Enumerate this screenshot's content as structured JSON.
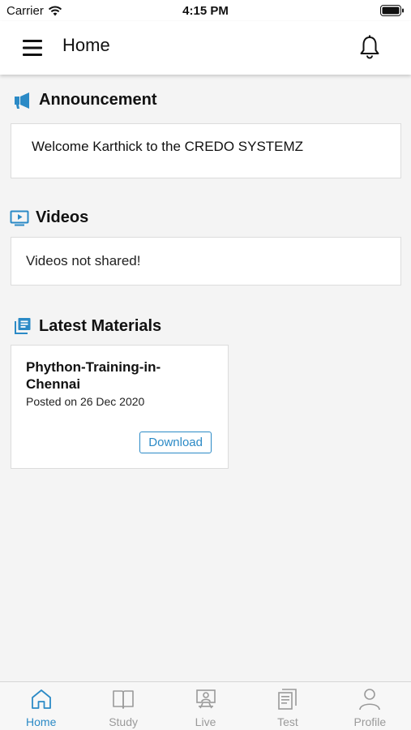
{
  "status_bar": {
    "carrier": "Carrier",
    "time": "4:15 PM"
  },
  "header": {
    "title": "Home",
    "menu_icon": "hamburger-menu-icon",
    "notification_icon": "bell-icon"
  },
  "announcement": {
    "heading": "Announcement",
    "icon": "megaphone-icon",
    "message": "Welcome Karthick to the CREDO SYSTEMZ"
  },
  "videos": {
    "heading": "Videos",
    "icon": "play-video-icon",
    "message": "Videos not shared!"
  },
  "materials": {
    "heading": "Latest Materials",
    "icon": "library-books-icon",
    "items": [
      {
        "title": "Phython-Training-in-Chennai",
        "posted": "Posted on 26 Dec 2020",
        "download_label": "Download"
      }
    ]
  },
  "tabs": [
    {
      "label": "Home",
      "icon": "home-icon",
      "active": true
    },
    {
      "label": "Study",
      "icon": "book-icon",
      "active": false
    },
    {
      "label": "Live",
      "icon": "live-class-icon",
      "active": false
    },
    {
      "label": "Test",
      "icon": "test-icon",
      "active": false
    },
    {
      "label": "Profile",
      "icon": "profile-icon",
      "active": false
    }
  ],
  "colors": {
    "accent": "#2b8ac6",
    "inactive_tab": "#9a9a9a",
    "background": "#f4f4f4"
  }
}
